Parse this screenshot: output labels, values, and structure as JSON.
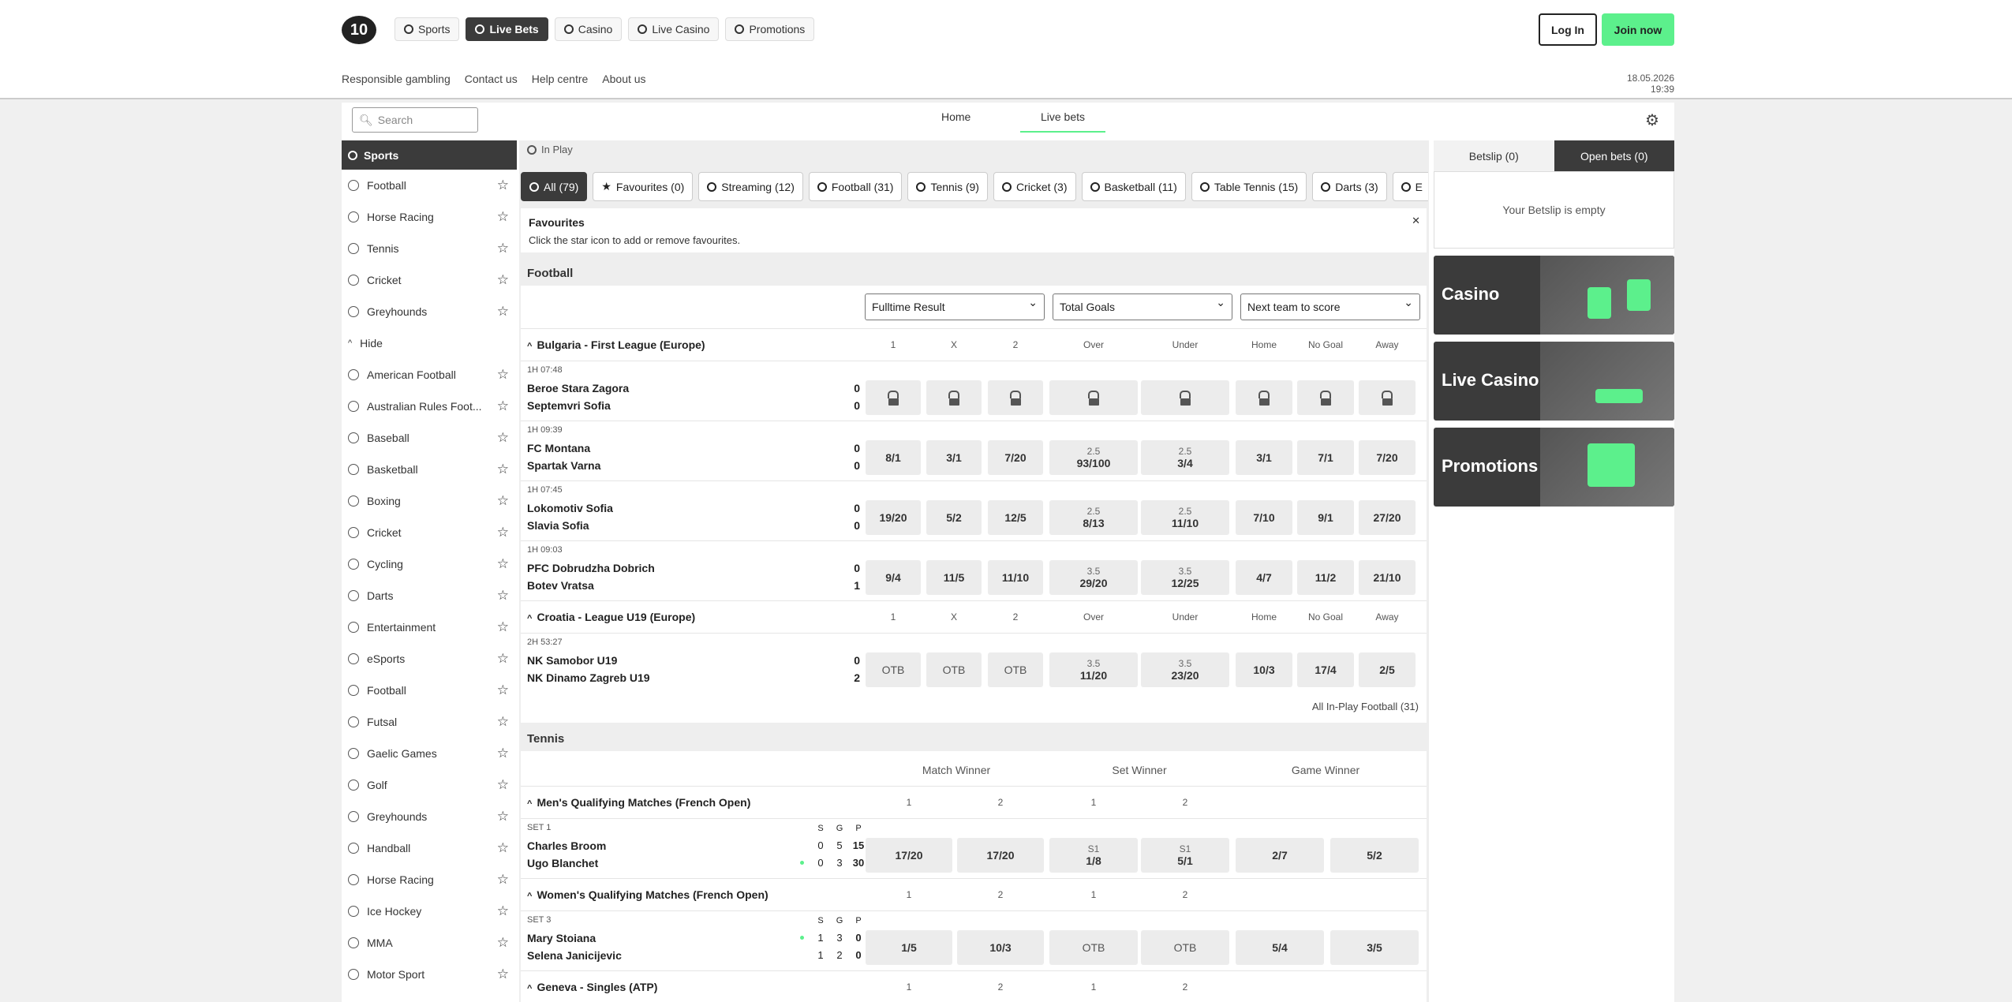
{
  "header": {
    "logo": "10",
    "nav": [
      {
        "label": "Sports",
        "active": false
      },
      {
        "label": "Live Bets",
        "active": true
      },
      {
        "label": "Casino",
        "active": false
      },
      {
        "label": "Live Casino",
        "active": false
      },
      {
        "label": "Promotions",
        "active": false
      }
    ],
    "login": "Log In",
    "join": "Join now",
    "links": [
      "Responsible gambling",
      "Contact us",
      "Help centre",
      "About us"
    ],
    "datetime": "18.05.2026 19:39"
  },
  "subnav": {
    "search_placeholder": "Search",
    "tabs": [
      "Home",
      "Live bets"
    ]
  },
  "sidebar": {
    "title": "Sports",
    "top": [
      "Football",
      "Horse Racing",
      "Tennis",
      "Cricket",
      "Greyhounds"
    ],
    "hide": "Hide",
    "all": [
      "American Football",
      "Australian Rules Foot...",
      "Baseball",
      "Basketball",
      "Boxing",
      "Cricket",
      "Cycling",
      "Darts",
      "Entertainment",
      "eSports",
      "Football",
      "Futsal",
      "Gaelic Games",
      "Golf",
      "Greyhounds",
      "Handball",
      "Horse Racing",
      "Ice Hockey",
      "MMA",
      "Motor Sport"
    ]
  },
  "main": {
    "inplay": "In Play",
    "filters": [
      "All (79)",
      "Favourites (0)",
      "Streaming (12)",
      "Football (31)",
      "Tennis (9)",
      "Cricket (3)",
      "Basketball (11)",
      "Table Tennis (15)",
      "Darts (3)",
      "E"
    ],
    "fav": {
      "title": "Favourites",
      "text": "Click the star icon to add or remove favourites."
    },
    "football": {
      "title": "Football",
      "selects": [
        "Fulltime Result",
        "Total Goals",
        "Next team to score"
      ],
      "cols": [
        "1",
        "X",
        "2",
        "Over",
        "Under",
        "Home",
        "No Goal",
        "Away"
      ],
      "all_link": "All In-Play Football (31)",
      "leagues": [
        {
          "name": "Bulgaria - First League (Europe)",
          "matches": [
            {
              "meta": "1H  07:48",
              "home": "Beroe Stara Zagora",
              "away": "Septemvri Sofia",
              "hs": "0",
              "as": "0",
              "odds": [
                [
                  "",
                  ""
                ],
                [
                  "",
                  ""
                ],
                [
                  "",
                  ""
                ],
                [
                  "",
                  ""
                ],
                [
                  "",
                  ""
                ],
                [
                  "",
                  ""
                ],
                [
                  "",
                  ""
                ],
                [
                  "",
                  ""
                ]
              ],
              "locked": true
            },
            {
              "meta": "1H  09:39",
              "home": "FC Montana",
              "away": "Spartak Varna",
              "hs": "0",
              "as": "0",
              "odds": [
                [
                  "",
                  "8/1"
                ],
                [
                  "",
                  "3/1"
                ],
                [
                  "",
                  "7/20"
                ],
                [
                  "2.5",
                  "93/100"
                ],
                [
                  "2.5",
                  "3/4"
                ],
                [
                  "",
                  "3/1"
                ],
                [
                  "",
                  "7/1"
                ],
                [
                  "",
                  "7/20"
                ]
              ]
            },
            {
              "meta": "1H  07:45",
              "home": "Lokomotiv Sofia",
              "away": "Slavia Sofia",
              "hs": "0",
              "as": "0",
              "odds": [
                [
                  "",
                  "19/20"
                ],
                [
                  "",
                  "5/2"
                ],
                [
                  "",
                  "12/5"
                ],
                [
                  "2.5",
                  "8/13"
                ],
                [
                  "2.5",
                  "11/10"
                ],
                [
                  "",
                  "7/10"
                ],
                [
                  "",
                  "9/1"
                ],
                [
                  "",
                  "27/20"
                ]
              ]
            },
            {
              "meta": "1H  09:03",
              "home": "PFC Dobrudzha Dobrich",
              "away": "Botev Vratsa",
              "hs": "0",
              "as": "1",
              "odds": [
                [
                  "",
                  "9/4"
                ],
                [
                  "",
                  "11/5"
                ],
                [
                  "",
                  "11/10"
                ],
                [
                  "3.5",
                  "29/20"
                ],
                [
                  "3.5",
                  "12/25"
                ],
                [
                  "",
                  "4/7"
                ],
                [
                  "",
                  "11/2"
                ],
                [
                  "",
                  "21/10"
                ]
              ]
            }
          ]
        },
        {
          "name": "Croatia - League U19 (Europe)",
          "matches": [
            {
              "meta": "2H  53:27",
              "home": "NK Samobor U19",
              "away": "NK Dinamo Zagreb U19",
              "hs": "0",
              "as": "2",
              "odds": [
                [
                  "",
                  "OTB"
                ],
                [
                  "",
                  "OTB"
                ],
                [
                  "",
                  "OTB"
                ],
                [
                  "3.5",
                  "11/20"
                ],
                [
                  "3.5",
                  "23/20"
                ],
                [
                  "",
                  "10/3"
                ],
                [
                  "",
                  "17/4"
                ],
                [
                  "",
                  "2/5"
                ]
              ]
            }
          ]
        }
      ]
    },
    "tennis": {
      "title": "Tennis",
      "groups": [
        "Match Winner",
        "Set Winner",
        "Game Winner"
      ],
      "cols": [
        "1",
        "2",
        "1",
        "2"
      ],
      "leagues": [
        {
          "name": "Men's Qualifying Matches (French Open)",
          "meta": "SET 1",
          "home": "Charles Broom",
          "away": "Ugo Blanchet",
          "sgp": [
            "S",
            "G",
            "P"
          ],
          "hsc": [
            "0",
            "5",
            "15"
          ],
          "asc": [
            "0",
            "3",
            "30"
          ],
          "serve": "away",
          "odds": [
            [
              "",
              "17/20"
            ],
            [
              "",
              "17/20"
            ],
            [
              "S1",
              "1/8"
            ],
            [
              "S1",
              "5/1"
            ],
            [
              "",
              "2/7"
            ],
            [
              "",
              "5/2"
            ]
          ]
        },
        {
          "name": "Women's Qualifying Matches (French Open)",
          "meta": "SET 3",
          "home": "Mary Stoiana",
          "away": "Selena Janicijevic",
          "sgp": [
            "S",
            "G",
            "P"
          ],
          "hsc": [
            "1",
            "3",
            "0"
          ],
          "asc": [
            "1",
            "2",
            "0"
          ],
          "serve": "home",
          "odds": [
            [
              "",
              "1/5"
            ],
            [
              "",
              "10/3"
            ],
            [
              "",
              "OTB"
            ],
            [
              "",
              "OTB"
            ],
            [
              "",
              "5/4"
            ],
            [
              "",
              "3/5"
            ]
          ]
        },
        {
          "name": "Geneva - Singles (ATP)"
        }
      ]
    }
  },
  "betslip": {
    "tabs": [
      "Betslip (0)",
      "Open bets (0)"
    ],
    "empty": "Your Betslip is empty",
    "promos": [
      "Casino",
      "Live Casino",
      "Promotions"
    ]
  },
  "colors": {
    "accent": "#5cf08c",
    "dark": "#3b3b3b"
  }
}
